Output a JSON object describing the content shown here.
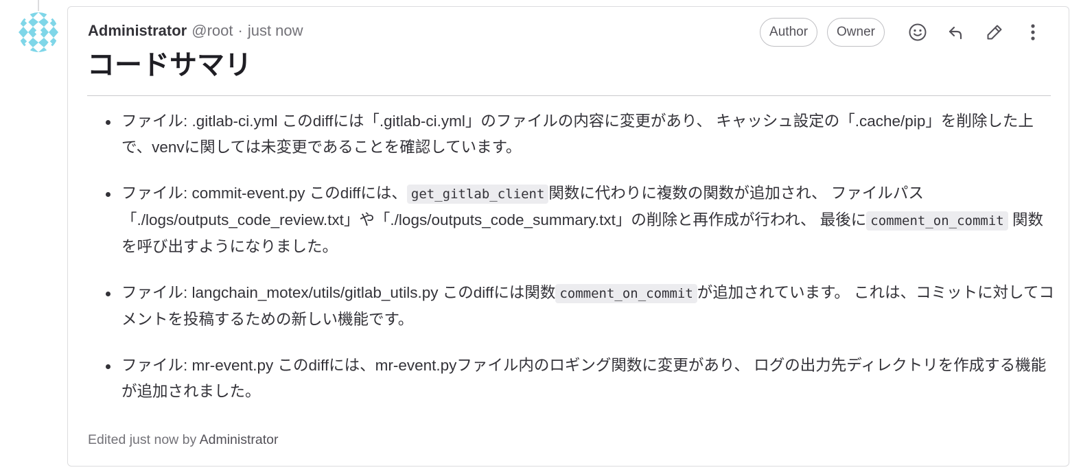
{
  "note": {
    "author_name": "Administrator",
    "author_handle": "@root",
    "separator": "·",
    "time": "just now",
    "badges": [
      "Author",
      "Owner"
    ],
    "title": "コードサマリ",
    "items": [
      {
        "segments": [
          {
            "text": "ファイル: .gitlab-ci.yml このdiffには「.gitlab-ci.yml」のファイルの内容に変更があり、 キャッシュ設定の「.cache/pip」を削除した上で、venvに関しては未変更であることを確認しています。"
          }
        ]
      },
      {
        "segments": [
          {
            "text": "ファイル: commit-event.py このdiffには、"
          },
          {
            "code": "get_gitlab_client"
          },
          {
            "text": "関数に代わりに複数の関数が追加され、 ファイルパス「./logs/outputs_code_review.txt」や「./logs/outputs_code_summary.txt」の削除と再作成が行われ、 最後に"
          },
          {
            "code": "comment_on_commit"
          },
          {
            "text": " 関数を呼び出すようになりました。"
          }
        ]
      },
      {
        "segments": [
          {
            "text": "ファイル: langchain_motex/utils/gitlab_utils.py このdiffには関数"
          },
          {
            "code": "comment_on_commit"
          },
          {
            "text": "が追加されています。 これは、コミットに対してコメントを投稿するための新しい機能です。"
          }
        ]
      },
      {
        "segments": [
          {
            "text": "ファイル: mr-event.py このdiffには、mr-event.pyファイル内のロギング関数に変更があり、 ログの出力先ディレクトリを作成する機能が追加されました。"
          }
        ]
      }
    ],
    "edited_prefix": "Edited just now by",
    "edited_by": "Administrator"
  },
  "icons": {
    "emoji": "smiley-icon",
    "reply": "reply-icon",
    "edit": "pencil-icon",
    "more": "kebab-menu-icon"
  },
  "colors": {
    "avatar_primary": "#7fd6e8",
    "text_primary": "#333238",
    "text_secondary": "#737278",
    "border": "#dcdcde"
  }
}
